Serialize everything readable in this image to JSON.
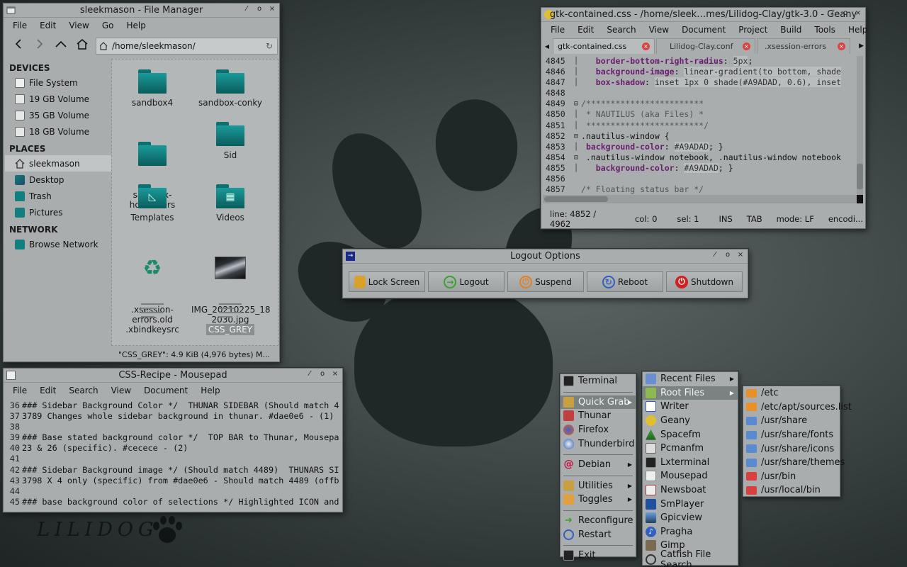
{
  "file_manager": {
    "title": "sleekmason - File Manager",
    "menu": [
      "File",
      "Edit",
      "View",
      "Go",
      "Help"
    ],
    "path": "/home/sleekmason/",
    "sidebar": {
      "devices_header": "DEVICES",
      "devices": [
        "File System",
        "19 GB Volume",
        "35 GB Volume",
        "18 GB Volume"
      ],
      "places_header": "PLACES",
      "places": [
        "sleekmason",
        "Desktop",
        "Trash",
        "Pictures"
      ],
      "network_header": "NETWORK",
      "network": [
        "Browse Network"
      ]
    },
    "items": [
      {
        "label": "sandbox4",
        "type": "folder"
      },
      {
        "label": "sandbox-conky",
        "type": "folder"
      },
      {
        "label": "sandbox-\nhotcorners",
        "type": "folder"
      },
      {
        "label": "Sid",
        "type": "folder"
      },
      {
        "label": "Templates",
        "type": "folder-templates"
      },
      {
        "label": "Videos",
        "type": "folder-videos"
      },
      {
        "label": ".xsession-\nerrors.old",
        "type": "recycle"
      },
      {
        "label": "IMG_20210225_18\n2030.jpg",
        "type": "image"
      },
      {
        "label": ".xbindkeysrc",
        "type": "text"
      },
      {
        "label": "CSS_GREY",
        "type": "text",
        "selected": true
      }
    ],
    "status": "\"CSS_GREY\": 4.9 KiB (4,976 bytes) M..."
  },
  "geany": {
    "title": "gtk-contained.css - /home/sleek…mes/Lilidog-Clay/gtk-3.0 - Geany",
    "menu": [
      "File",
      "Edit",
      "Search",
      "View",
      "Document",
      "Project",
      "Build",
      "Tools",
      "Help"
    ],
    "tabs": [
      "gtk-contained.css",
      "Lilidog-Clay.conf",
      ".xsession-errors"
    ],
    "lines": [
      {
        "n": "4845",
        "fold": "│",
        "code": [
          [
            "    ",
            ""
          ],
          [
            "border-bottom-right-radius",
            ": kw"
          ],
          [
            ": ",
            ""
          ],
          [
            "5px",
            ""
          ],
          [
            ";",
            ""
          ]
        ]
      },
      {
        "n": "4846",
        "fold": "│",
        "code": [
          [
            "    ",
            ""
          ],
          [
            "background-image",
            ""
          ],
          [
            ": ",
            ""
          ],
          [
            "linear-gradient(to bottom, shade",
            ""
          ]
        ]
      },
      {
        "n": "4847",
        "fold": "│",
        "code": [
          [
            "    ",
            ""
          ],
          [
            "box-shadow",
            ""
          ],
          [
            ": ",
            ""
          ],
          [
            "inset 1px 0 shade(#A9ADAD, 0.6), inset",
            ""
          ]
        ]
      },
      {
        "n": "4848",
        "fold": "",
        "code": []
      },
      {
        "n": "4849",
        "fold": "⊟",
        "code": []
      },
      {
        "n": "4850",
        "fold": "│",
        "code": []
      },
      {
        "n": "4851",
        "fold": "│",
        "code": []
      },
      {
        "n": "4852",
        "fold": "⊟",
        "code": []
      },
      {
        "n": "4853",
        "fold": "│",
        "code": []
      },
      {
        "n": "4854",
        "fold": "⊟",
        "code": []
      },
      {
        "n": "4855",
        "fold": "│",
        "code": []
      },
      {
        "n": "4856",
        "fold": "",
        "code": []
      },
      {
        "n": "4857",
        "fold": "",
        "code": []
      }
    ],
    "text": {
      "l4845_prop": "border-bottom-right-radius",
      "l4845_val": "5px",
      "l4846_prop": "background-image",
      "l4846_val": "linear-gradient(to bottom, shade",
      "l4847_prop": "box-shadow",
      "l4847_val": "inset 1px 0 shade(#A9ADAD, 0.6), inset",
      "l4849": "/************************",
      "l4850": " * NAUTILUS (aka Files) *",
      "l4851": " ************************/",
      "l4852": ".nautilus-window {",
      "l4853_prop": "background-color",
      "l4853_val": "#A9ADAD",
      "l4854": " .nautilus-window notebook, .nautilus-window notebook",
      "l4855_prop": "background-color",
      "l4855_val": "#A9ADAD",
      "l4857": "/* Floating status bar */"
    },
    "status": {
      "line": "line: 4852 / 4962",
      "col": "col: 0",
      "sel": "sel: 1",
      "ins": "INS",
      "tab": "TAB",
      "mode": "mode: LF",
      "enc": "encodi..."
    }
  },
  "logout": {
    "title": "Logout Options",
    "buttons": [
      "Lock Screen",
      "Logout",
      "Suspend",
      "Reboot",
      "Shutdown"
    ]
  },
  "mousepad": {
    "title": "CSS-Recipe - Mousepad",
    "menu": [
      "File",
      "Edit",
      "Search",
      "View",
      "Document",
      "Help"
    ],
    "lines": [
      {
        "n": "36",
        "t": "### Sidebar Background Color */  THUNAR SIDEBAR (Should match 4"
      },
      {
        "n": "37",
        "t": "3789 Changes whole sidebar background in thunar. #dae0e6 - (1)"
      },
      {
        "n": "38",
        "t": ""
      },
      {
        "n": "39",
        "t": "### Base stated background color */  TOP BAR to Thunar, Mousepa"
      },
      {
        "n": "40",
        "t": "23 & 26 (specific). #cecece - (2)"
      },
      {
        "n": "41",
        "t": ""
      },
      {
        "n": "42",
        "t": "### Sidebar Background image */ (Should match 4489)  THUNARS SI"
      },
      {
        "n": "43",
        "t": "3798 X 4 only (specific) from #dae0e6 - Should match 4489 (offb"
      },
      {
        "n": "44",
        "t": ""
      },
      {
        "n": "45",
        "t": "### base background color of selections */ Highlighted ICON and"
      }
    ]
  },
  "logo": "LILIDOG",
  "root_menu": {
    "items": [
      {
        "label": "Terminal",
        "icon": "terminal-icon",
        "sep_after": true
      },
      {
        "label": "Quick Grab",
        "icon": "quickgrab-icon",
        "arrow": true,
        "highlight": true
      },
      {
        "label": "Thunar",
        "icon": "thunar-icon"
      },
      {
        "label": "Firefox",
        "icon": "firefox-icon"
      },
      {
        "label": "Thunderbird",
        "icon": "thunderbird-icon",
        "sep_after": true
      },
      {
        "label": "Debian",
        "icon": "debian-icon",
        "arrow": true,
        "sep_after": true
      },
      {
        "label": "Utilities",
        "icon": "utilities-icon",
        "arrow": true
      },
      {
        "label": "Toggles",
        "icon": "toggles-icon",
        "arrow": true,
        "sep_after": true
      },
      {
        "label": "Reconfigure",
        "icon": "reconfigure-icon"
      },
      {
        "label": "Restart",
        "icon": "restart-icon",
        "sep_after": true
      },
      {
        "label": "Exit",
        "icon": "exit-icon"
      }
    ]
  },
  "quickgrab_menu": {
    "items": [
      {
        "label": "Recent Files",
        "arrow": true
      },
      {
        "label": "Root Files",
        "arrow": true,
        "highlight": true
      },
      {
        "label": "Writer"
      },
      {
        "label": "Geany"
      },
      {
        "label": "Spacefm"
      },
      {
        "label": "Pcmanfm"
      },
      {
        "label": "Lxterminal"
      },
      {
        "label": "Mousepad"
      },
      {
        "label": "Newsboat"
      },
      {
        "label": "SmPlayer"
      },
      {
        "label": "Gpicview"
      },
      {
        "label": "Pragha"
      },
      {
        "label": "Gimp"
      },
      {
        "label": "Catfish File Search"
      }
    ]
  },
  "rootfiles_menu": {
    "items": [
      "/etc",
      "/etc/apt/sources.list",
      "/usr/share",
      "/usr/share/fonts",
      "/usr/share/icons",
      "/usr/share/themes",
      "/usr/bin",
      "/usr/local/bin"
    ]
  },
  "colors": {
    "accent": "#0f7f7f",
    "panel": "#a9adad",
    "highlight": "#7a8282"
  }
}
